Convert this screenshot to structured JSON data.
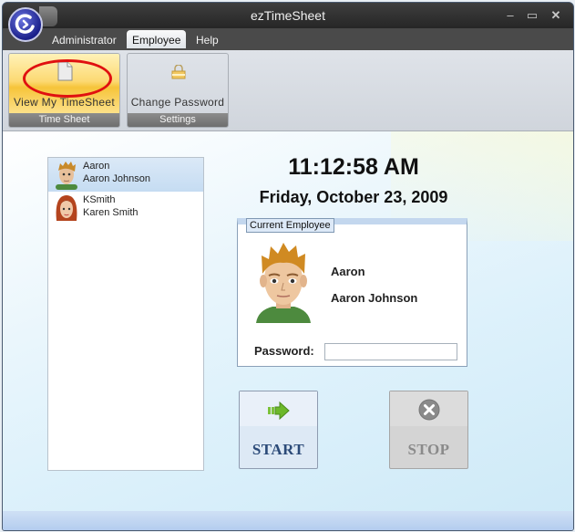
{
  "window": {
    "title": "ezTimeSheet",
    "controls": {
      "minimize": "‒",
      "maximize": "▭",
      "close": "✕"
    }
  },
  "menu": {
    "items": [
      {
        "label": "Administrator",
        "active": false
      },
      {
        "label": "Employee",
        "active": true
      },
      {
        "label": "Help",
        "active": false
      }
    ]
  },
  "ribbon": {
    "groups": [
      {
        "label": "Time Sheet",
        "button": {
          "label": "View My TimeSheet",
          "icon": "document-icon",
          "highlighted": true
        }
      },
      {
        "label": "Settings",
        "button": {
          "label": "Change Password",
          "icon": "lock-icon",
          "highlighted": false
        }
      }
    ]
  },
  "employees": [
    {
      "username": "Aaron",
      "full_name": "Aaron Johnson",
      "selected": true,
      "avatar": "male-avatar"
    },
    {
      "username": "KSmith",
      "full_name": "Karen Smith",
      "selected": false,
      "avatar": "female-avatar"
    }
  ],
  "clock": {
    "time": "11:12:58 AM",
    "date": "Friday, October 23, 2009"
  },
  "current_employee": {
    "legend": "Current Employee",
    "username": "Aaron",
    "full_name": "Aaron Johnson",
    "password_label": "Password:",
    "password_value": ""
  },
  "actions": {
    "start_label": "START",
    "stop_label": "STOP"
  },
  "colors": {
    "annotation_ellipse": "#e01010",
    "start_text": "#2b4a78",
    "stop_text": "#8a8a8a",
    "highlight": "#f6c43a"
  }
}
